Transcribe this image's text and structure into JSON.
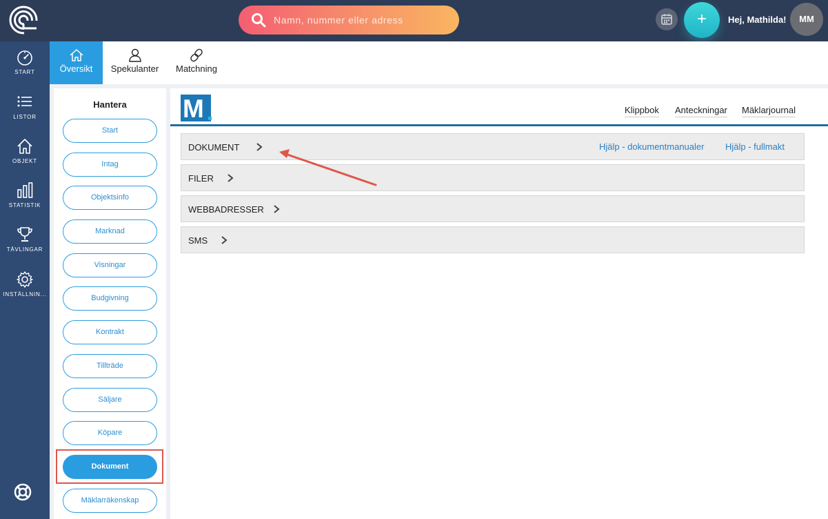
{
  "header": {
    "search_placeholder": "Namn, nummer eller adress",
    "greeting": "Hej, Mathilda!",
    "avatar_initials": "MM"
  },
  "sidebar": {
    "items": [
      {
        "label": "START",
        "icon": "speedometer-icon"
      },
      {
        "label": "LISTOR",
        "icon": "list-icon"
      },
      {
        "label": "OBJEKT",
        "icon": "house-icon"
      },
      {
        "label": "STATISTIK",
        "icon": "bar-chart-icon"
      },
      {
        "label": "TÄVLINGAR",
        "icon": "trophy-icon"
      },
      {
        "label": "INSTÄLLNIN...",
        "icon": "gear-icon"
      }
    ],
    "help_icon": "lifebuoy-icon"
  },
  "tabs": [
    {
      "label": "Översikt",
      "icon": "house-icon",
      "active": true
    },
    {
      "label": "Spekulanter",
      "icon": "user-icon",
      "active": false
    },
    {
      "label": "Matchning",
      "icon": "link-icon",
      "active": false
    }
  ],
  "manage": {
    "title": "Hantera",
    "items": [
      "Start",
      "Intag",
      "Objektsinfo",
      "Marknad",
      "Visningar",
      "Budgivning",
      "Kontrakt",
      "Tillträde",
      "Säljare",
      "Köpare",
      "Dokument",
      "Mäklarräkenskap"
    ],
    "active": "Dokument"
  },
  "main": {
    "brand_letter": "M",
    "top_links": [
      "Klippbok",
      "Anteckningar",
      "Mäklarjournal"
    ],
    "sections": [
      {
        "title": "DOKUMENT"
      },
      {
        "title": "FILER"
      },
      {
        "title": "WEBBADRESSER"
      },
      {
        "title": "SMS"
      }
    ],
    "help_links": [
      "Hjälp - dokumentmanualer",
      "Hjälp - fullmakt"
    ]
  },
  "colors": {
    "topbar": "#2d3c57",
    "sidebar": "#2f4a73",
    "accent": "#2a9de0",
    "highlight": "#e0564a"
  }
}
